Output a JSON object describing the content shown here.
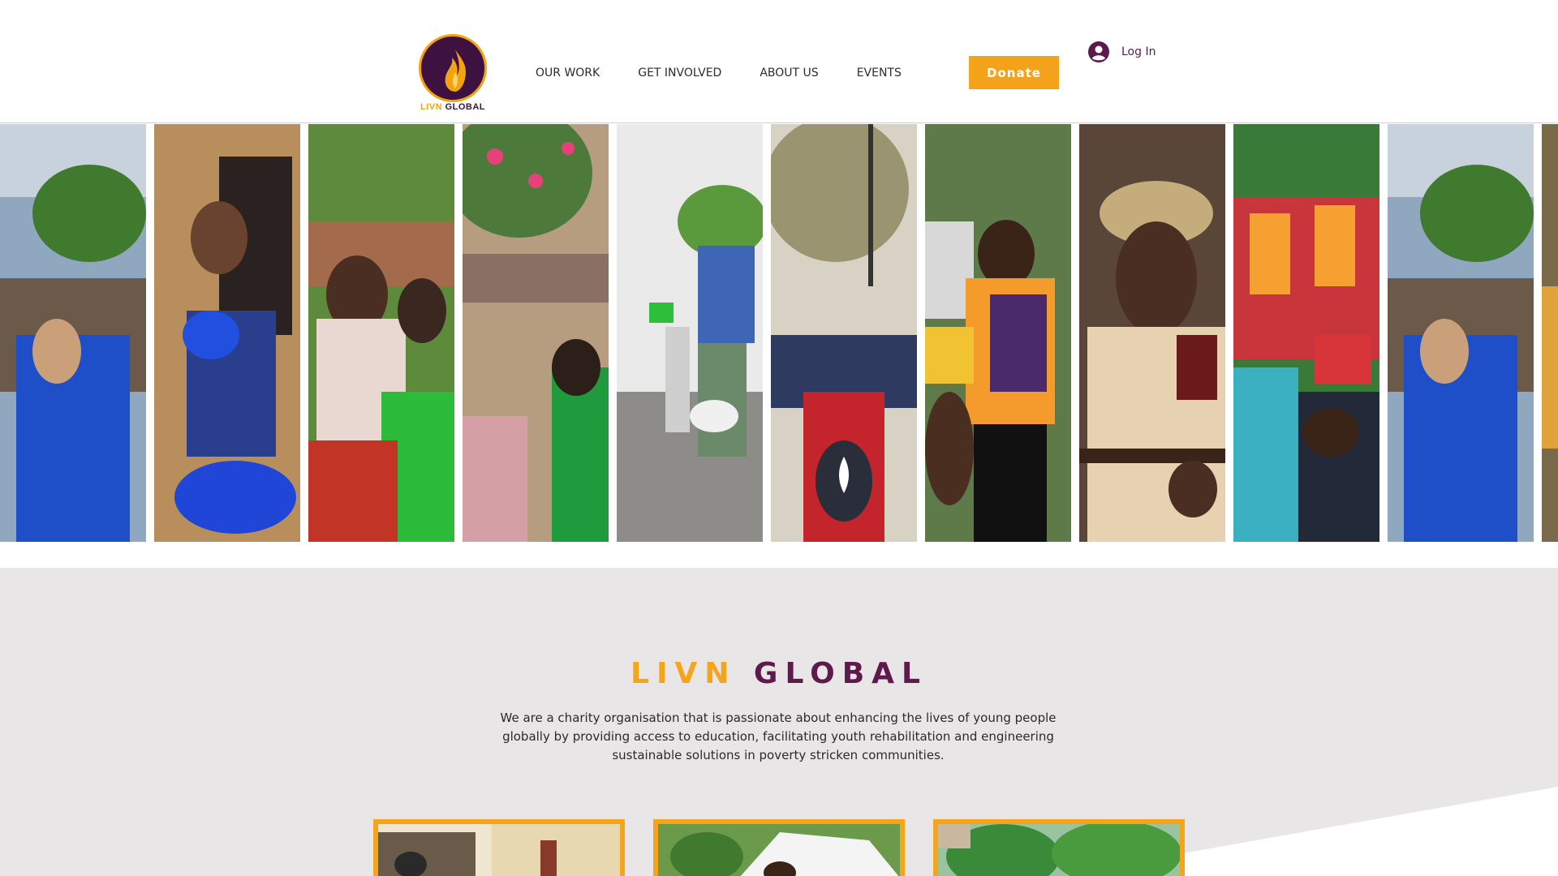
{
  "header": {
    "logo": {
      "name": "livn-global-logo",
      "text_part1": "LIVN",
      "text_part2": "GLOBAL",
      "ring_color": "#f2a30f",
      "fill_color": "#3d1240"
    },
    "nav": [
      {
        "label": "OUR WORK"
      },
      {
        "label": "GET INVOLVED"
      },
      {
        "label": "ABOUT US"
      },
      {
        "label": "EVENTS"
      }
    ],
    "donate_label": "Donate",
    "login_label": "Log In"
  },
  "gallery": {
    "photos": [
      {
        "description": "women-in-blue-shirts"
      },
      {
        "description": "woman-with-blue-bucket"
      },
      {
        "description": "women-in-patterned-wraps"
      },
      {
        "description": "crowd-under-flowering-tree"
      },
      {
        "description": "men-at-water-pump"
      },
      {
        "description": "children-with-backpacks"
      },
      {
        "description": "woman-holding-supplies"
      },
      {
        "description": "official-in-uniform"
      },
      {
        "description": "speakers-on-truck"
      },
      {
        "description": "women-in-blue-shirts"
      }
    ]
  },
  "about": {
    "title_part1": "LIVN",
    "title_part2": "GLOBAL",
    "description": "We are a charity organisation that is passionate about enhancing the lives of young people globally by providing access to education, facilitating youth rehabilitation and engineering sustainable solutions in poverty stricken communities."
  },
  "cards": [
    {
      "description": "building-with-people"
    },
    {
      "description": "tent-gathering"
    },
    {
      "description": "trees-outdoors"
    }
  ],
  "colors": {
    "accent": "#f4a51c",
    "brand_purple": "#5d1a4a",
    "section_bg": "#e9e6e8"
  }
}
